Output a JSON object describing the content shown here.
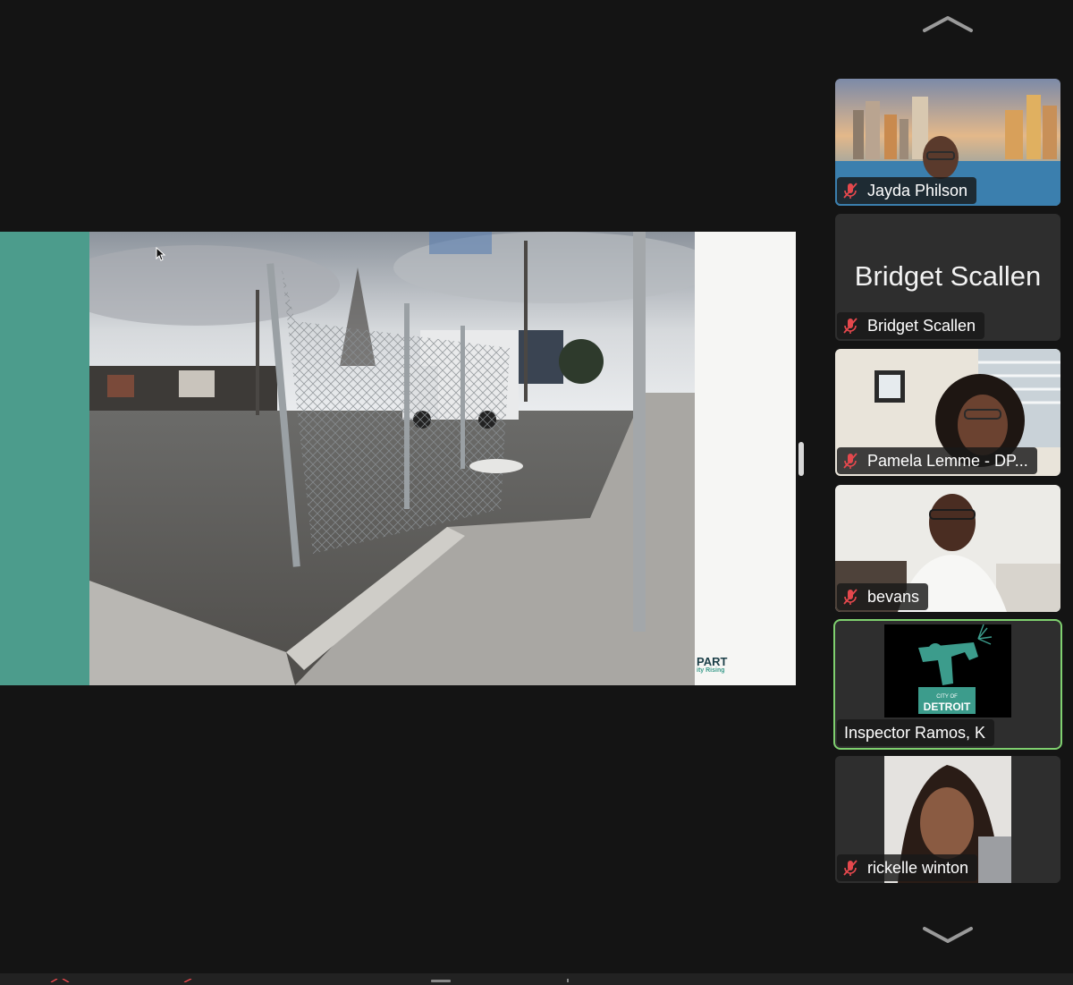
{
  "shared_screen": {
    "brand_title": "PART",
    "brand_subtitle": "ity Rising"
  },
  "gallery": {
    "scroll_up_icon": "chevron-up-icon",
    "scroll_down_icon": "chevron-down-icon",
    "participants": [
      {
        "name": "Jayda Philson",
        "muted": true,
        "video": "city-skyline-background"
      },
      {
        "name": "Bridget Scallen",
        "display_name": "Bridget Scallen",
        "muted": true,
        "video": "off"
      },
      {
        "name": "Pamela Lemme - DP...",
        "muted": true,
        "video": "on"
      },
      {
        "name": "bevans",
        "muted": true,
        "video": "on"
      },
      {
        "name": "Inspector Ramos, K",
        "muted": false,
        "active_speaker": true,
        "video": "city-of-detroit-logo",
        "logo_text_1": "CITY OF",
        "logo_text_2": "DETROIT"
      },
      {
        "name": "rickelle winton",
        "muted": true,
        "video": "on"
      }
    ]
  },
  "colors": {
    "background": "#141414",
    "tile": "#2e2e2e",
    "active_speaker_border": "#7fd06f",
    "muted_icon": "#e5484d",
    "accent_teal": "#4c9c8c"
  }
}
